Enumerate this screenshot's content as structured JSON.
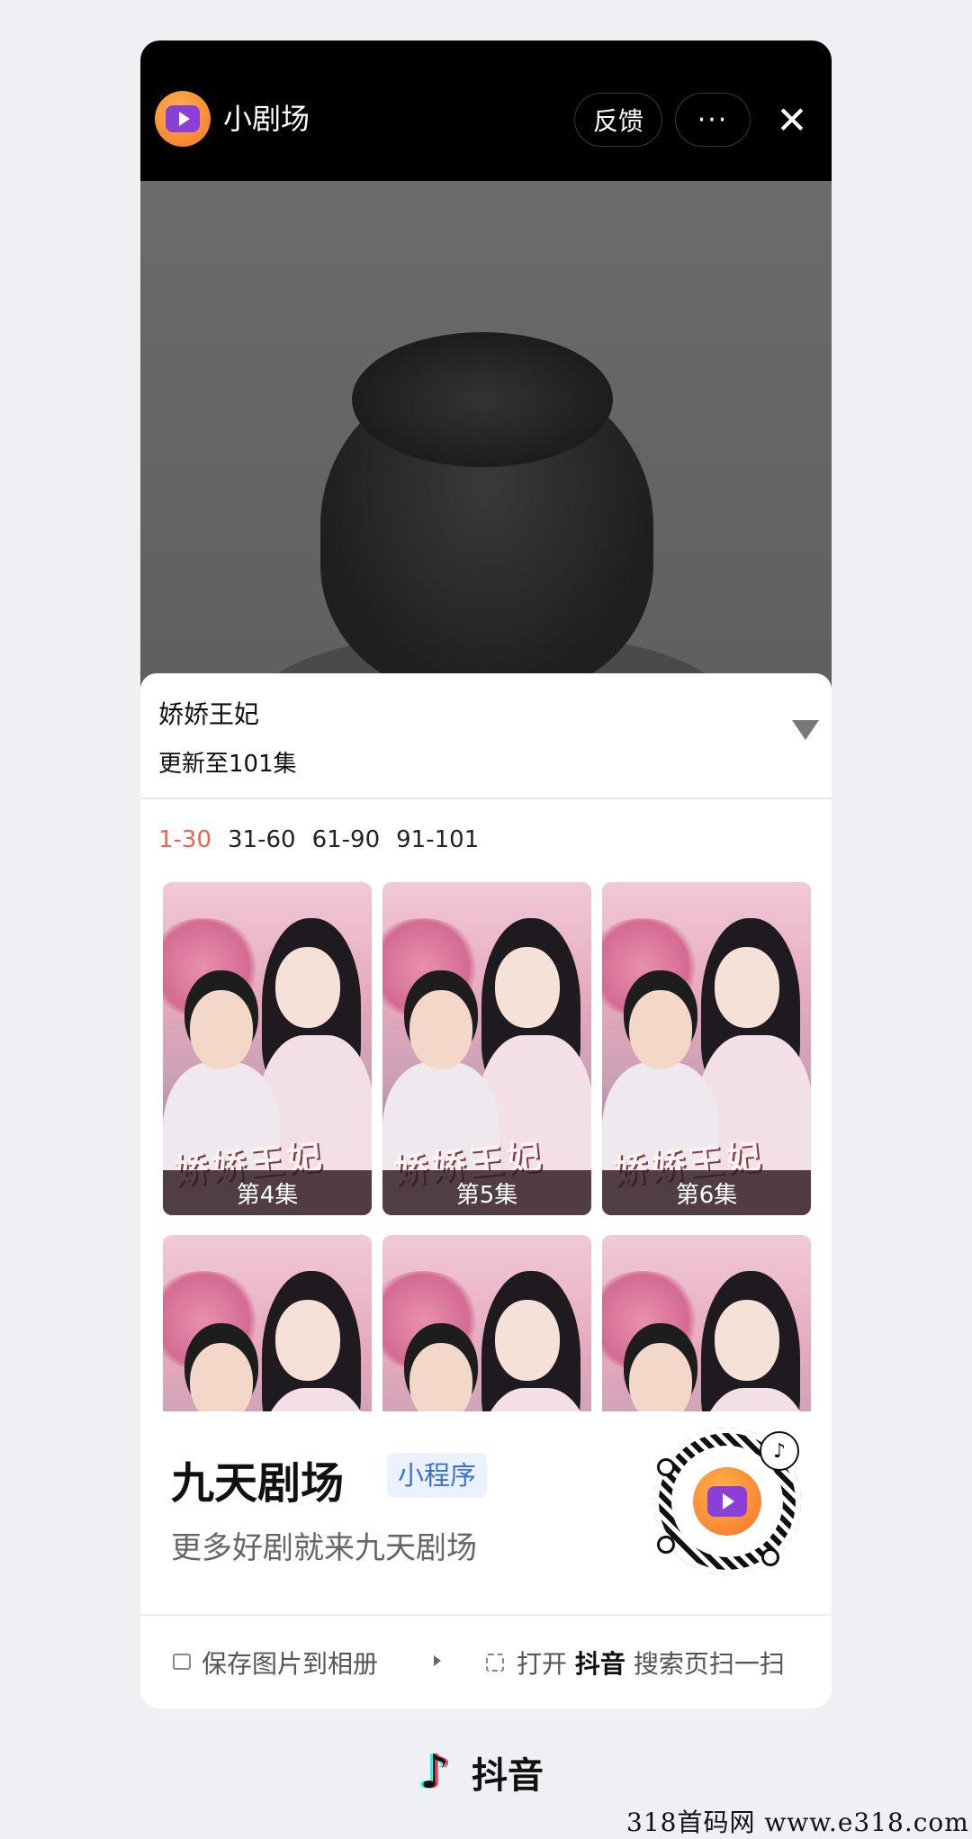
{
  "header": {
    "app_name": "小剧场",
    "feedback_label": "反馈",
    "more_label": "···",
    "close_label": "✕"
  },
  "drama": {
    "title": "娇娇王妃",
    "update_status": "更新至101集"
  },
  "episode_ranges": [
    {
      "label": "1-30",
      "active": true
    },
    {
      "label": "31-60",
      "active": false
    },
    {
      "label": "61-90",
      "active": false
    },
    {
      "label": "91-101",
      "active": false
    }
  ],
  "episodes": [
    {
      "label": "第4集"
    },
    {
      "label": "第5集"
    },
    {
      "label": "第6集"
    },
    {
      "label": ""
    },
    {
      "label": ""
    },
    {
      "label": ""
    }
  ],
  "poster": {
    "calligraphy_title": "娇娇王妃"
  },
  "promo": {
    "title": "九天剧场",
    "badge": "小程序",
    "subtitle": "更多好剧就来九天剧场"
  },
  "actions": {
    "save_label": "保存图片到相册",
    "open_prefix": "打开",
    "open_app": "抖音",
    "open_suffix": "搜索页扫一扫"
  },
  "footer": {
    "brand": "抖音"
  },
  "watermark": "318首码网  www.e318.com",
  "colors": {
    "active_range": "#e8664a",
    "badge_text": "#3b6fd6",
    "badge_bg": "#eaf2ff",
    "page_bg": "#eff0f4"
  }
}
